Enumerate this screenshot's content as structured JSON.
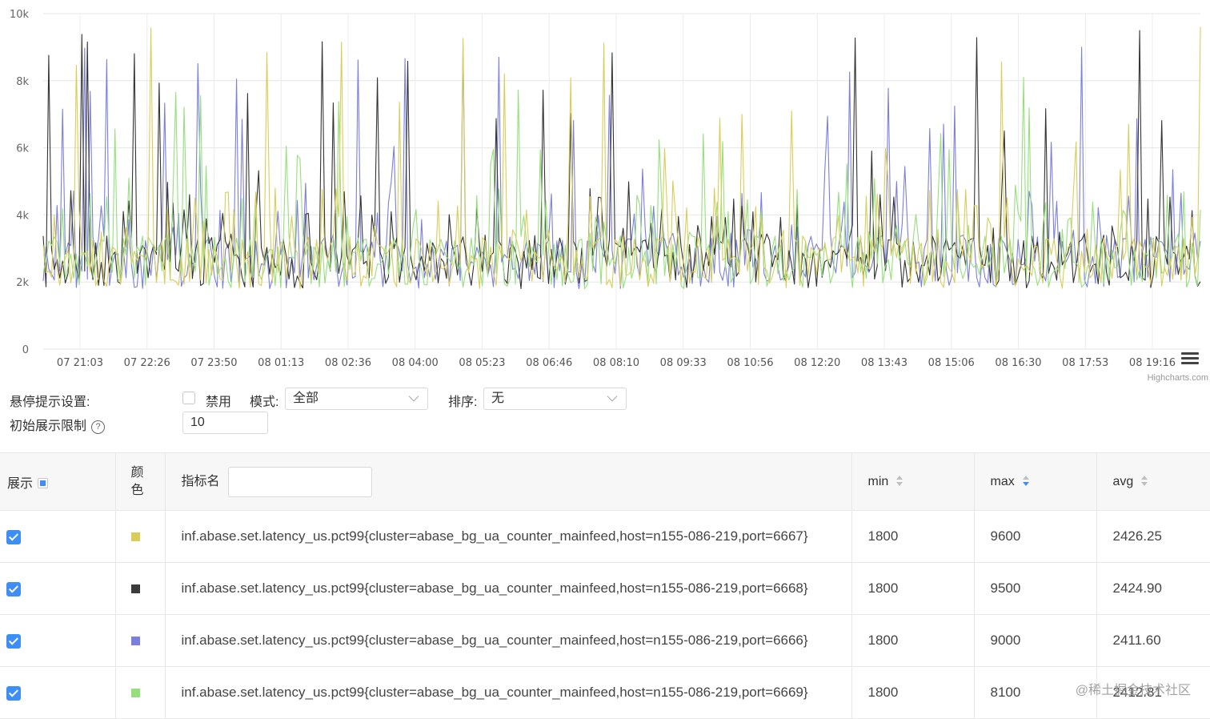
{
  "chart_data": {
    "type": "line",
    "yticks": [
      "0",
      "2k",
      "4k",
      "6k",
      "8k",
      "10k"
    ],
    "ytick_values": [
      0,
      2000,
      4000,
      6000,
      8000,
      10000
    ],
    "ylim": [
      0,
      10000
    ],
    "xticks": [
      "07 21:03",
      "07 22:26",
      "07 23:50",
      "08 01:13",
      "08 02:36",
      "08 04:00",
      "08 05:23",
      "08 06:46",
      "08 08:10",
      "08 09:33",
      "08 10:56",
      "08 12:20",
      "08 13:43",
      "08 15:06",
      "08 16:30",
      "08 17:53",
      "08 19:16"
    ],
    "grid": true,
    "legend": "none",
    "series": [
      {
        "color": "#d9cd5a",
        "min": 1800,
        "max": 9600,
        "avg": 2426.25
      },
      {
        "color": "#333333",
        "min": 1800,
        "max": 9500,
        "avg": 2424.9
      },
      {
        "color": "#7b7fdc",
        "min": 1800,
        "max": 9000,
        "avg": 2411.6
      },
      {
        "color": "#95e07d",
        "min": 1800,
        "max": 8100,
        "avg": 2412.81
      }
    ]
  },
  "credits": "Highcharts.com",
  "controls": {
    "hover_label": "悬停提示设置:",
    "disable_label": "禁用",
    "mode_label": "模式:",
    "mode_value": "全部",
    "sort_label": "排序:",
    "sort_value": "无",
    "limit_label": "初始展示限制",
    "limit_value": "10",
    "help_glyph": "?"
  },
  "table": {
    "headers": {
      "show": "展示",
      "color": "颜色",
      "name": "指标名",
      "min": "min",
      "max": "max",
      "avg": "avg"
    },
    "rows": [
      {
        "color": "#d9cd5a",
        "name": "inf.abase.set.latency_us.pct99{cluster=abase_bg_ua_counter_mainfeed,host=n155-086-219,port=6667}",
        "min": "1800",
        "max": "9600",
        "avg": "2426.25"
      },
      {
        "color": "#3b3b3b",
        "name": "inf.abase.set.latency_us.pct99{cluster=abase_bg_ua_counter_mainfeed,host=n155-086-219,port=6668}",
        "min": "1800",
        "max": "9500",
        "avg": "2424.90"
      },
      {
        "color": "#7b7fdc",
        "name": "inf.abase.set.latency_us.pct99{cluster=abase_bg_ua_counter_mainfeed,host=n155-086-219,port=6666}",
        "min": "1800",
        "max": "9000",
        "avg": "2411.60"
      },
      {
        "color": "#95e07d",
        "name": "inf.abase.set.latency_us.pct99{cluster=abase_bg_ua_counter_mainfeed,host=n155-086-219,port=6669}",
        "min": "1800",
        "max": "8100",
        "avg": "2412.81"
      }
    ]
  },
  "watermark": "@稀土掘金技术社区"
}
